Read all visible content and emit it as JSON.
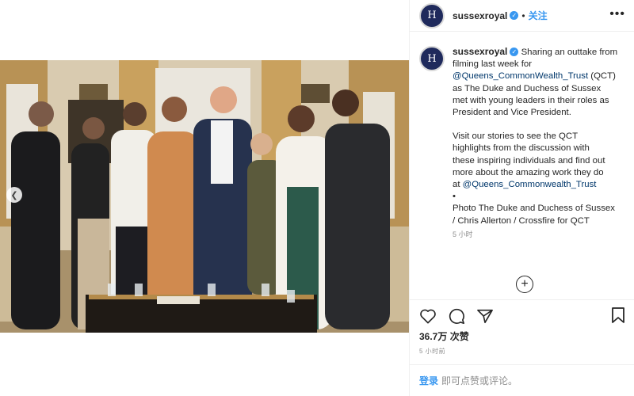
{
  "post": {
    "username": "sussexroyal",
    "follow_label": "关注",
    "more_label": "•••",
    "caption": {
      "lines1": [
        "Sharing an outtake from",
        "filming last week for"
      ],
      "mention1": "@Queens_CommonWealth_Trust",
      "line1_tail": " (QCT)",
      "lines1b": [
        "as The Duke and Duchess of Sussex",
        "met with young leaders in their roles as",
        "President and Vice President."
      ],
      "para2": [
        "Visit our stories to see the QCT",
        "highlights from the discussion with",
        "these inspiring individuals and find out",
        "more about the amazing work they do"
      ],
      "para2_prefix": "at ",
      "mention2": "@Queens_Commonwealth_Trust",
      "bullet": "•",
      "credit": [
        "Photo The Duke and Duchess of Sussex",
        "/ Chris Allerton / Crossfire for QCT"
      ],
      "time": "5 小时"
    },
    "plus_label": "+",
    "likes": "36.7万 次赞",
    "post_time": "5 小时前",
    "login_link": "登录",
    "login_text": "即可点赞或评论。",
    "avatar_glyph": "H"
  },
  "icons": [
    "heart-icon",
    "comment-icon",
    "share-icon",
    "bookmark-icon",
    "verified-icon",
    "chevron-left-icon"
  ],
  "colors": {
    "accent": "#3897f0",
    "mention": "#00376b",
    "muted": "#8e8e8e"
  }
}
